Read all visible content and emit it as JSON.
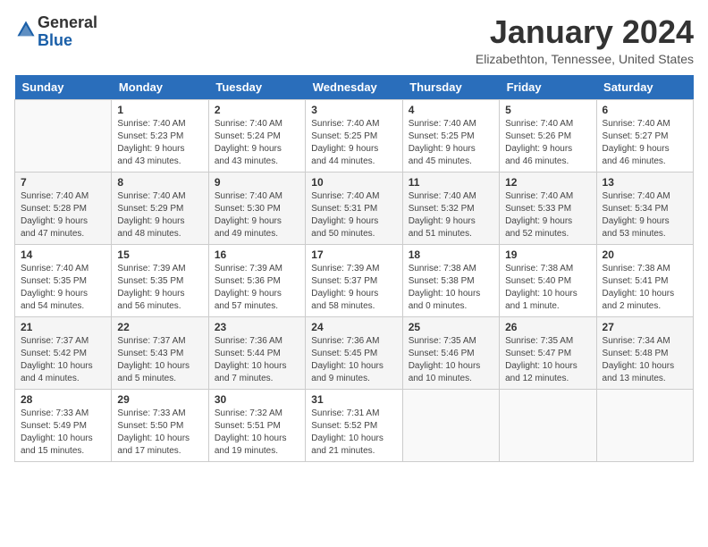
{
  "header": {
    "logo_general": "General",
    "logo_blue": "Blue",
    "title": "January 2024",
    "subtitle": "Elizabethton, Tennessee, United States"
  },
  "calendar": {
    "days_of_week": [
      "Sunday",
      "Monday",
      "Tuesday",
      "Wednesday",
      "Thursday",
      "Friday",
      "Saturday"
    ],
    "weeks": [
      [
        {
          "day": "",
          "info": ""
        },
        {
          "day": "1",
          "info": "Sunrise: 7:40 AM\nSunset: 5:23 PM\nDaylight: 9 hours\nand 43 minutes."
        },
        {
          "day": "2",
          "info": "Sunrise: 7:40 AM\nSunset: 5:24 PM\nDaylight: 9 hours\nand 43 minutes."
        },
        {
          "day": "3",
          "info": "Sunrise: 7:40 AM\nSunset: 5:25 PM\nDaylight: 9 hours\nand 44 minutes."
        },
        {
          "day": "4",
          "info": "Sunrise: 7:40 AM\nSunset: 5:25 PM\nDaylight: 9 hours\nand 45 minutes."
        },
        {
          "day": "5",
          "info": "Sunrise: 7:40 AM\nSunset: 5:26 PM\nDaylight: 9 hours\nand 46 minutes."
        },
        {
          "day": "6",
          "info": "Sunrise: 7:40 AM\nSunset: 5:27 PM\nDaylight: 9 hours\nand 46 minutes."
        }
      ],
      [
        {
          "day": "7",
          "info": "Sunrise: 7:40 AM\nSunset: 5:28 PM\nDaylight: 9 hours\nand 47 minutes."
        },
        {
          "day": "8",
          "info": "Sunrise: 7:40 AM\nSunset: 5:29 PM\nDaylight: 9 hours\nand 48 minutes."
        },
        {
          "day": "9",
          "info": "Sunrise: 7:40 AM\nSunset: 5:30 PM\nDaylight: 9 hours\nand 49 minutes."
        },
        {
          "day": "10",
          "info": "Sunrise: 7:40 AM\nSunset: 5:31 PM\nDaylight: 9 hours\nand 50 minutes."
        },
        {
          "day": "11",
          "info": "Sunrise: 7:40 AM\nSunset: 5:32 PM\nDaylight: 9 hours\nand 51 minutes."
        },
        {
          "day": "12",
          "info": "Sunrise: 7:40 AM\nSunset: 5:33 PM\nDaylight: 9 hours\nand 52 minutes."
        },
        {
          "day": "13",
          "info": "Sunrise: 7:40 AM\nSunset: 5:34 PM\nDaylight: 9 hours\nand 53 minutes."
        }
      ],
      [
        {
          "day": "14",
          "info": "Sunrise: 7:40 AM\nSunset: 5:35 PM\nDaylight: 9 hours\nand 54 minutes."
        },
        {
          "day": "15",
          "info": "Sunrise: 7:39 AM\nSunset: 5:35 PM\nDaylight: 9 hours\nand 56 minutes."
        },
        {
          "day": "16",
          "info": "Sunrise: 7:39 AM\nSunset: 5:36 PM\nDaylight: 9 hours\nand 57 minutes."
        },
        {
          "day": "17",
          "info": "Sunrise: 7:39 AM\nSunset: 5:37 PM\nDaylight: 9 hours\nand 58 minutes."
        },
        {
          "day": "18",
          "info": "Sunrise: 7:38 AM\nSunset: 5:38 PM\nDaylight: 10 hours\nand 0 minutes."
        },
        {
          "day": "19",
          "info": "Sunrise: 7:38 AM\nSunset: 5:40 PM\nDaylight: 10 hours\nand 1 minute."
        },
        {
          "day": "20",
          "info": "Sunrise: 7:38 AM\nSunset: 5:41 PM\nDaylight: 10 hours\nand 2 minutes."
        }
      ],
      [
        {
          "day": "21",
          "info": "Sunrise: 7:37 AM\nSunset: 5:42 PM\nDaylight: 10 hours\nand 4 minutes."
        },
        {
          "day": "22",
          "info": "Sunrise: 7:37 AM\nSunset: 5:43 PM\nDaylight: 10 hours\nand 5 minutes."
        },
        {
          "day": "23",
          "info": "Sunrise: 7:36 AM\nSunset: 5:44 PM\nDaylight: 10 hours\nand 7 minutes."
        },
        {
          "day": "24",
          "info": "Sunrise: 7:36 AM\nSunset: 5:45 PM\nDaylight: 10 hours\nand 9 minutes."
        },
        {
          "day": "25",
          "info": "Sunrise: 7:35 AM\nSunset: 5:46 PM\nDaylight: 10 hours\nand 10 minutes."
        },
        {
          "day": "26",
          "info": "Sunrise: 7:35 AM\nSunset: 5:47 PM\nDaylight: 10 hours\nand 12 minutes."
        },
        {
          "day": "27",
          "info": "Sunrise: 7:34 AM\nSunset: 5:48 PM\nDaylight: 10 hours\nand 13 minutes."
        }
      ],
      [
        {
          "day": "28",
          "info": "Sunrise: 7:33 AM\nSunset: 5:49 PM\nDaylight: 10 hours\nand 15 minutes."
        },
        {
          "day": "29",
          "info": "Sunrise: 7:33 AM\nSunset: 5:50 PM\nDaylight: 10 hours\nand 17 minutes."
        },
        {
          "day": "30",
          "info": "Sunrise: 7:32 AM\nSunset: 5:51 PM\nDaylight: 10 hours\nand 19 minutes."
        },
        {
          "day": "31",
          "info": "Sunrise: 7:31 AM\nSunset: 5:52 PM\nDaylight: 10 hours\nand 21 minutes."
        },
        {
          "day": "",
          "info": ""
        },
        {
          "day": "",
          "info": ""
        },
        {
          "day": "",
          "info": ""
        }
      ]
    ]
  }
}
